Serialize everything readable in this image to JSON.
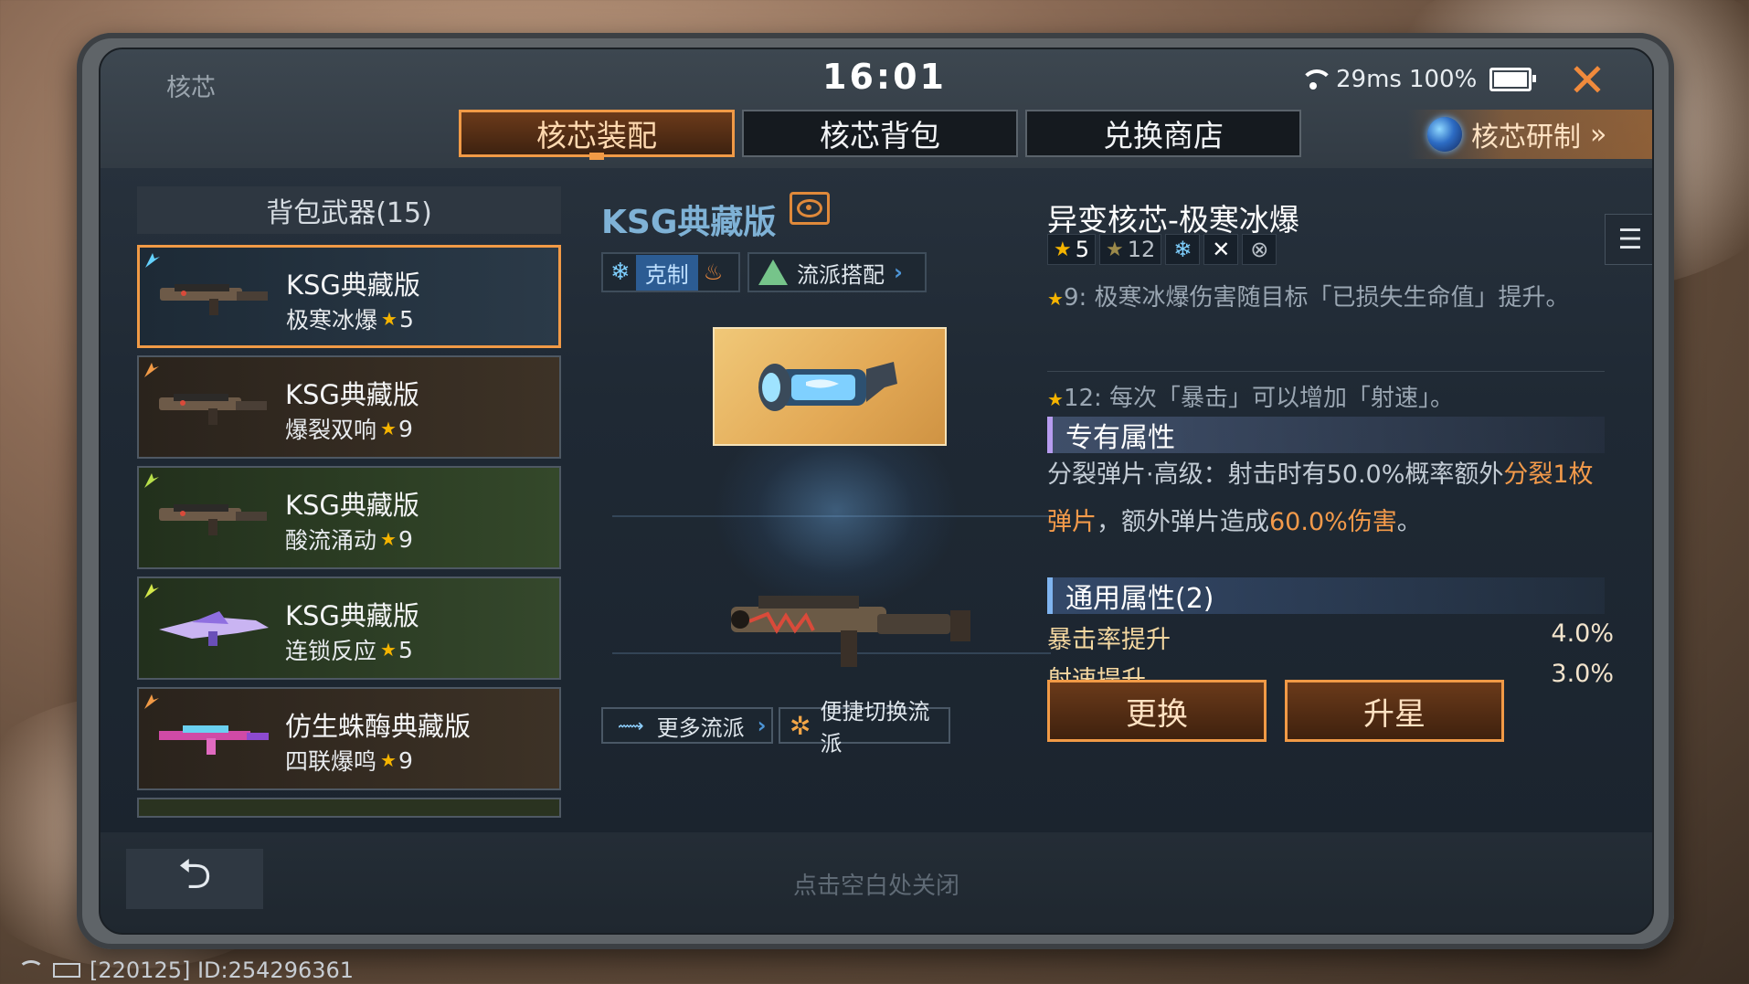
{
  "header": {
    "title": "核芯",
    "clock": "16:01",
    "ping": "29ms",
    "battery": "100%",
    "close_icon": "close-icon"
  },
  "tabs": [
    {
      "label": "核芯装配",
      "active": true
    },
    {
      "label": "核芯背包",
      "active": false
    },
    {
      "label": "兑换商店",
      "active": false
    }
  ],
  "research": {
    "label": "核芯研制",
    "arrow": "»"
  },
  "left": {
    "header": "背包武器(15)",
    "items": [
      {
        "name": "KSG典藏版",
        "core": "极寒冰爆",
        "stars": "5",
        "selected": true,
        "bg": "#25313d"
      },
      {
        "name": "KSG典藏版",
        "core": "爆裂双响",
        "stars": "9",
        "selected": false,
        "bg": "#3a3023"
      },
      {
        "name": "KSG典藏版",
        "core": "酸流涌动",
        "stars": "9",
        "selected": false,
        "bg": "#2c3a22"
      },
      {
        "name": "KSG典藏版",
        "core": "连锁反应",
        "stars": "5",
        "selected": false,
        "bg": "#2f3a24"
      },
      {
        "name": "仿生蛛酶典藏版",
        "core": "四联爆鸣",
        "stars": "9",
        "selected": false,
        "bg": "#3b2f22"
      }
    ]
  },
  "middle": {
    "weapon_title": "KSG典藏版",
    "counter_label": "克制",
    "school_label": "流派搭配",
    "more_schools": "更多流派",
    "quick_switch": "便捷切换流派"
  },
  "right": {
    "title": "异变核芯-极寒冰爆",
    "badge_star_1": "5",
    "badge_star_2": "12",
    "desc_1_prefix": "9:",
    "desc_1_text": "极寒冰爆伤害随目标「已损失生命值」提升。",
    "desc_2_prefix": "12:",
    "desc_2_text": "每次「暴击」可以增加「射速」。",
    "exclusive_header": "专有属性",
    "exclusive_text_a": "分裂弹片·高级：射击时有50.0%概率额外",
    "exclusive_text_hl": "分裂1枚弹片",
    "exclusive_text_b": "，额外弹片造成",
    "exclusive_text_c": "60.0%伤害",
    "exclusive_text_d": "。",
    "general_header": "通用属性(2)",
    "stats": [
      {
        "label": "暴击率提升",
        "value": "4.0%"
      },
      {
        "label": "射速提升",
        "value": "3.0%"
      }
    ],
    "replace_btn": "更换",
    "upgrade_btn": "升星"
  },
  "bottom": {
    "back_icon": "back-arrow-icon",
    "hint": "点击空白处关闭"
  },
  "footer": {
    "build": "[220125] ID:254296361"
  },
  "colors": {
    "accent": "#f19a46",
    "star": "#f5b400",
    "highlight": "#f39a4a"
  }
}
